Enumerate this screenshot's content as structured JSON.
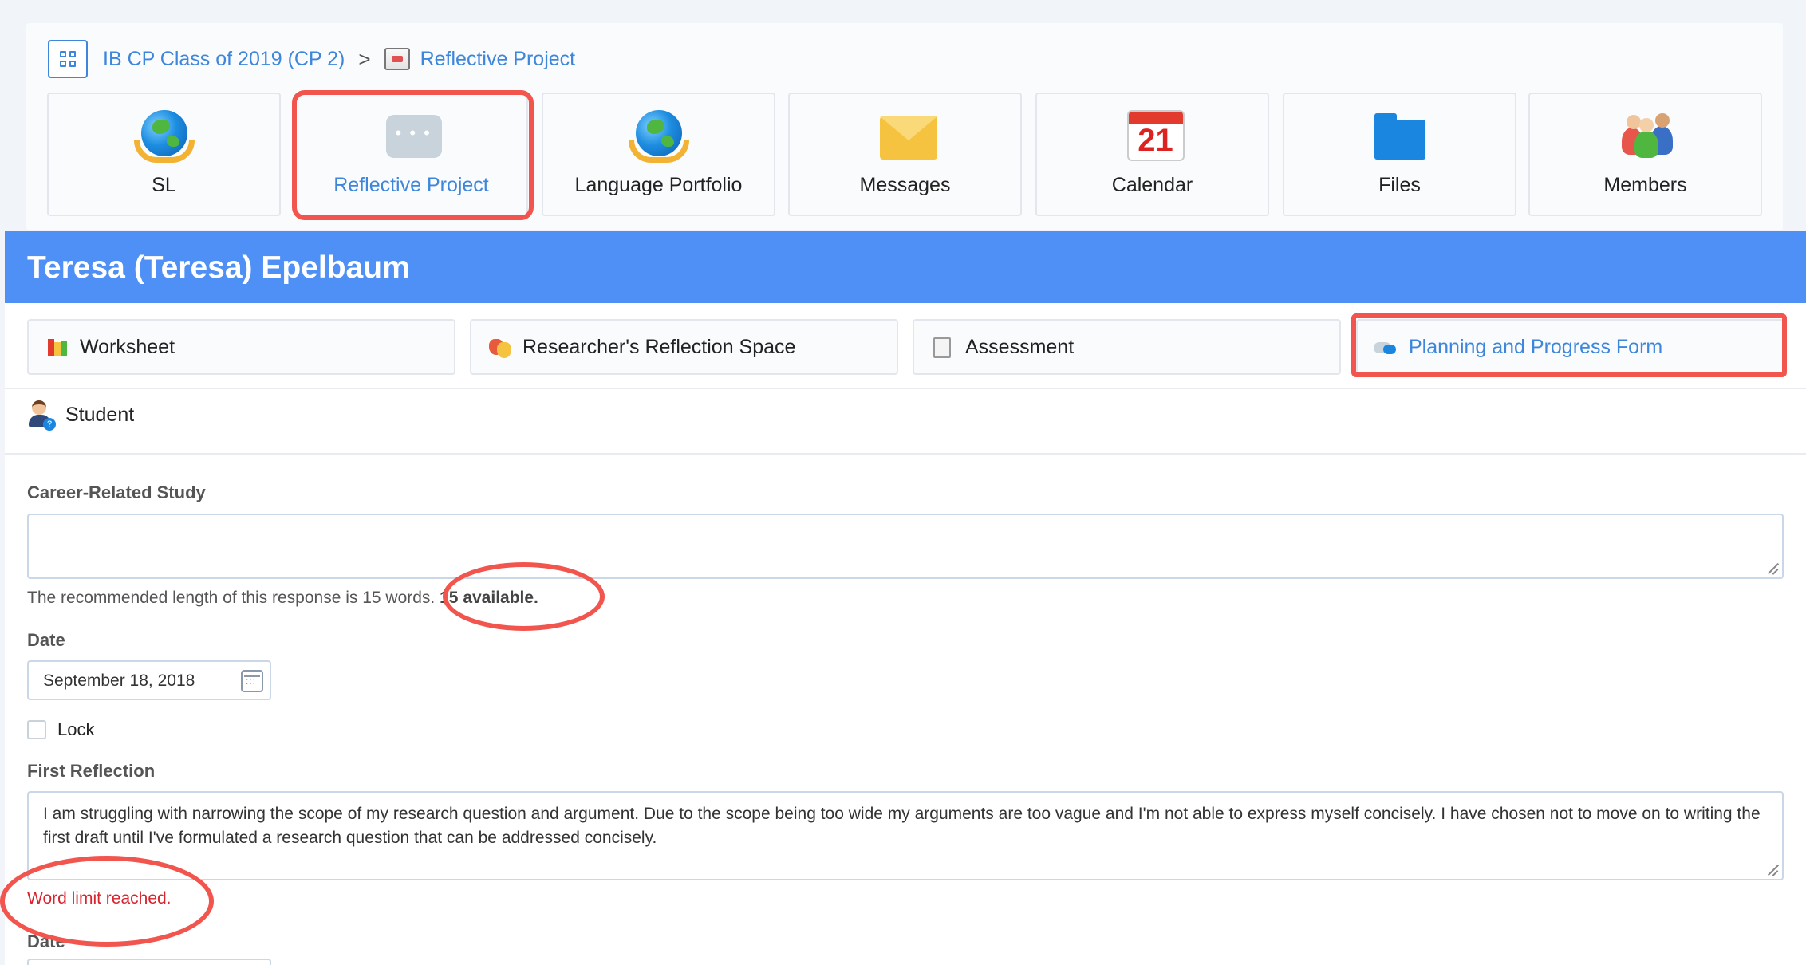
{
  "breadcrumb": {
    "class_name": "IB CP Class of 2019 (CP 2)",
    "separator": ">",
    "current": "Reflective Project"
  },
  "tiles": [
    {
      "label": "SL",
      "icon": "globe-hands-icon",
      "active": false
    },
    {
      "label": "Reflective Project",
      "icon": "chat-bubble-icon",
      "active": true
    },
    {
      "label": "Language Portfolio",
      "icon": "globe-hands-icon",
      "active": false
    },
    {
      "label": "Messages",
      "icon": "envelope-icon",
      "active": false
    },
    {
      "label": "Calendar",
      "icon": "calendar-icon",
      "active": false,
      "day": "21"
    },
    {
      "label": "Files",
      "icon": "folder-icon",
      "active": false
    },
    {
      "label": "Members",
      "icon": "people-icon",
      "active": false
    }
  ],
  "student_name": "Teresa (Teresa) Epelbaum",
  "tabs": [
    {
      "label": "Worksheet",
      "icon": "books-icon",
      "active": false
    },
    {
      "label": "Researcher's Reflection Space",
      "icon": "masks-icon",
      "active": false
    },
    {
      "label": "Assessment",
      "icon": "notepad-icon",
      "active": false
    },
    {
      "label": "Planning and Progress Form",
      "icon": "speech-bubbles-icon",
      "active": true
    }
  ],
  "role": "Student",
  "form": {
    "career_label": "Career-Related Study",
    "career_value": "",
    "career_hint_prefix": "The recommended length of this response is 15 words.",
    "career_hint_available": "15 available.",
    "date_label_1": "Date",
    "date_value_1": "September 18, 2018",
    "lock_label": "Lock",
    "first_reflection_label": "First Reflection",
    "first_reflection_value": "I am struggling with narrowing the scope of my research question and argument. Due to the scope being too wide my arguments are too vague and I'm not able to express myself concisely. I have chosen not to move on to writing the first draft until I've formulated a research question that can be addressed concisely.",
    "word_limit_warning": "Word limit reached.",
    "date_label_2": "Date"
  },
  "colors": {
    "accent": "#3d86dc",
    "header_blue": "#4e90f5",
    "highlight_red": "#f2554d",
    "warning_red": "#d9232d"
  }
}
